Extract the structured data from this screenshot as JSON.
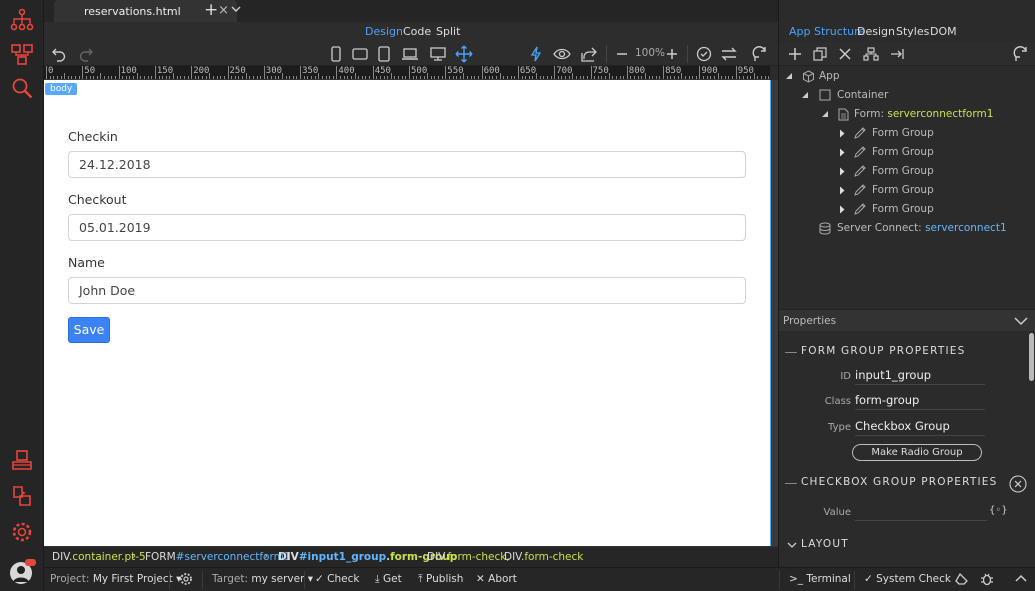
{
  "tabs": {
    "file_name": "reservations.html",
    "close": "×",
    "add": "+"
  },
  "view_modes": {
    "design": "Design",
    "code": "Code",
    "split": "Split",
    "active": "design"
  },
  "toolbar": {
    "zoom": "100%"
  },
  "ruler": {
    "labels": [
      "0",
      "50",
      "100",
      "150",
      "200",
      "250",
      "300",
      "350",
      "400",
      "450",
      "500",
      "550",
      "600",
      "650",
      "700",
      "750",
      "800",
      "850",
      "900",
      "950"
    ]
  },
  "canvas": {
    "body_badge": "body",
    "fields": [
      {
        "label": "Checkin",
        "value": "24.12.2018"
      },
      {
        "label": "Checkout",
        "value": "05.01.2019"
      },
      {
        "label": "Name",
        "value": "John Doe"
      }
    ],
    "save_label": "Save"
  },
  "breadcrumb": [
    {
      "tag": "DIV",
      "id": "",
      "cls": ".container.pt-5",
      "bold": false,
      "sep": "›"
    },
    {
      "tag": "FORM",
      "id": "#serverconnectform1",
      "cls": "",
      "bold": false,
      "sep": "›"
    },
    {
      "tag": "DIV",
      "id": "#input1_group",
      "cls": ".form-group",
      "bold": true,
      "sep": "›"
    },
    {
      "tag": "DIV",
      "id": "",
      "cls": ".form-check,",
      "bold": false,
      "sep": ""
    },
    {
      "tag": "DIV",
      "id": "",
      "cls": ".form-check",
      "bold": false,
      "sep": ""
    }
  ],
  "status": {
    "project_label": "Project:",
    "project_value": "My First Project",
    "target_label": "Target:",
    "target_value": "my server",
    "check": "Check",
    "get": "Get",
    "publish": "Publish",
    "abort": "Abort",
    "terminal": "Terminal",
    "system_check": "System Check"
  },
  "right_tabs": {
    "app_structure": "App Structure",
    "design": "Design",
    "styles": "Styles",
    "dom": "DOM",
    "active": "app_structure"
  },
  "tree": {
    "app": "App",
    "container": "Container",
    "form_prefix": "Form:",
    "form_name": "serverconnectform1",
    "form_groups": [
      "Form Group",
      "Form Group",
      "Form Group",
      "Form Group",
      "Form Group"
    ],
    "server_connect_prefix": "Server Connect:",
    "server_connect_name": "serverconnect1"
  },
  "properties": {
    "header": "Properties",
    "section1": "FORM GROUP PROPERTIES",
    "id_label": "ID",
    "id_value": "input1_group",
    "class_label": "Class",
    "class_value": "form-group",
    "type_label": "Type",
    "type_value": "Checkbox Group",
    "make_radio": "Make Radio Group",
    "section2": "CHECKBOX GROUP PROPERTIES",
    "value_label": "Value",
    "value_token": "{◦}",
    "section3": "LAYOUT"
  },
  "colors": {
    "accent": "#4aa3ff",
    "highlight": "#c8e24a",
    "button": "#3b82f6",
    "logo": "#e8453c"
  }
}
